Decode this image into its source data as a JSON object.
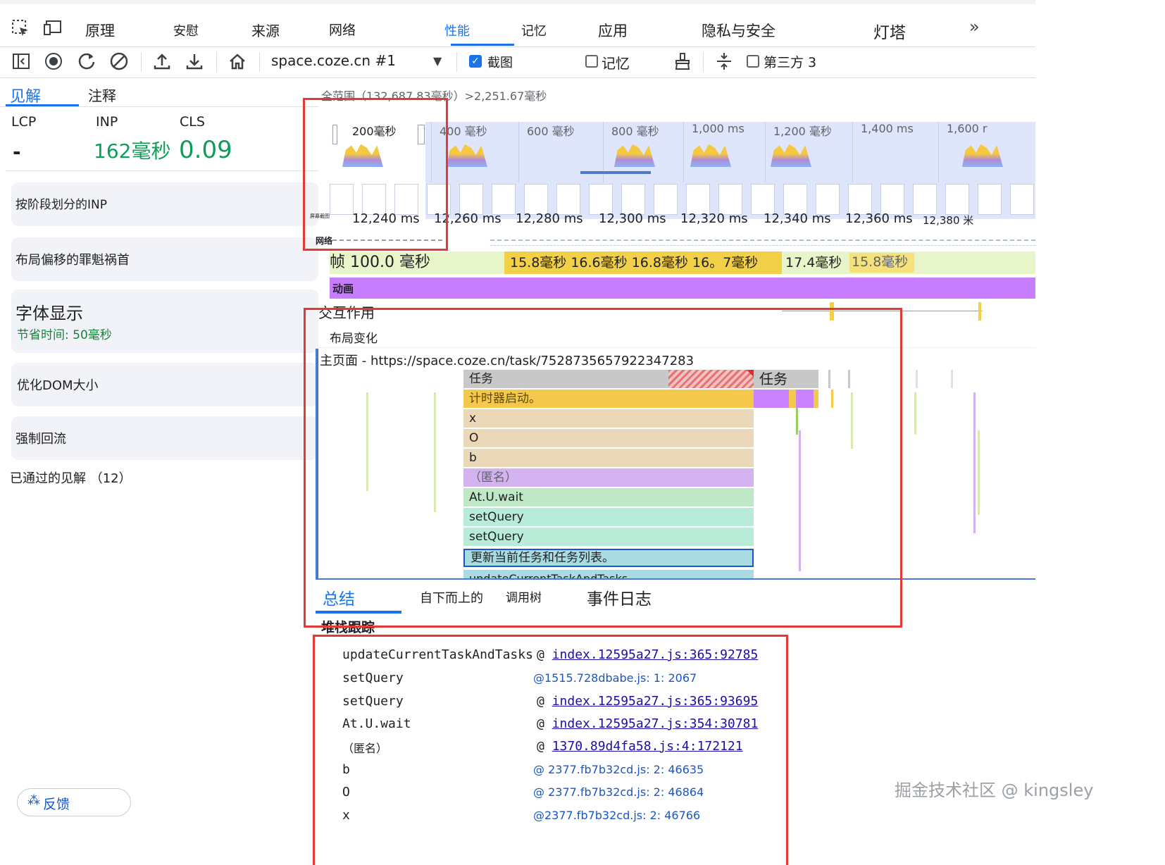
{
  "tabs": [
    "原理",
    "安慰",
    "来源",
    "网络",
    "性能",
    "记忆",
    "应用",
    "隐私与安全",
    "灯塔"
  ],
  "tabs_more": "»",
  "toolbar": {
    "target": "space.coze.cn #1",
    "screenshots_label": "截图",
    "memory_label": "记忆",
    "third_party_label": "第三方 3"
  },
  "sidebar": {
    "tabs": [
      "见解",
      "注释"
    ],
    "metrics": {
      "lcp_label": "LCP",
      "lcp_value": "-",
      "inp_label": "INP",
      "inp_value": "162毫秒",
      "cls_label": "CLS",
      "cls_value": "0.09"
    },
    "cards": {
      "inp_phase": "按阶段划分的INP",
      "layout_shift": "布局偏移的罪魁祸首",
      "font_display": "字体显示",
      "font_saving": "节省时间: 50毫秒",
      "dom_size": "优化DOM大小",
      "forced_reflow": "强制回流"
    },
    "passed": "已通过的见解 （12）",
    "feedback": "反馈"
  },
  "timeline": {
    "range": "全范围（132,687.83毫秒）>2,251.67毫秒",
    "overview_ticks": [
      "200毫秒",
      "400 毫秒",
      "600 毫秒",
      "800 毫秒",
      "1,000 ms",
      "1,200 毫秒",
      "1,400 ms",
      "1,600 r"
    ],
    "ruler_ticks": [
      "12,240 ms",
      "12,260 ms",
      "12,280 ms",
      "12,300 ms",
      "12,320 ms",
      "12,340 ms",
      "12,360 ms",
      "12,380 米"
    ],
    "screenshots_lane_label": "屏幕截图",
    "network_label": "网络",
    "frames_label": "帧 100.0 毫秒",
    "frame_times": "15.8毫秒 16.6毫秒 16.8毫秒 16。7毫秒",
    "frame_time_2": "17.4毫秒",
    "frame_time_3": "15.8毫秒",
    "animation_label": "动画",
    "interactions_label": "交互作用",
    "layout_shifts_label": "布局变化",
    "main_thread": "主页面 - https://space.coze.cn/task/7528735657922347283",
    "flame": {
      "task": "任务",
      "task2": "任务",
      "timer": "计时器启动。",
      "x": "x",
      "o": "O",
      "b": "b",
      "anon": "（匿名）",
      "wait": "At.U.wait",
      "setquery1": "setQuery",
      "setquery2": "setQuery",
      "update_cn": "更新当前任务和任务列表。",
      "update_fn": "updateCurrentTaskAndTasks"
    }
  },
  "bottom": {
    "tabs": [
      "总结",
      "自下而上的",
      "调用树",
      "事件日志"
    ],
    "stack_title": "堆栈跟踪",
    "stack": [
      {
        "fn": "updateCurrentTaskAndTasks",
        "at": "@",
        "src": "index.12595a27.js:365:92785"
      },
      {
        "fn": "setQuery",
        "at": "",
        "src": "@1515.728dbabe.js: 1: 2067"
      },
      {
        "fn": "setQuery",
        "at": "@",
        "src": "index.12595a27.js:365:93695"
      },
      {
        "fn": "At.U.wait",
        "at": "@",
        "src": "index.12595a27.js:354:30781"
      },
      {
        "fn": "（匿名）",
        "at": "@",
        "src": "1370.89d4fa58.js:4:172121"
      },
      {
        "fn": "b",
        "at": "",
        "src": "@ 2377.fb7b32cd.js: 2: 46635"
      },
      {
        "fn": "O",
        "at": "",
        "src": "@ 2377.fb7b32cd.js: 2: 46864"
      },
      {
        "fn": "x",
        "at": "",
        "src": "@2377.fb7b32cd.js: 2: 46766"
      }
    ]
  },
  "watermark": "掘金技术社区 @ kingsley",
  "colors": {
    "accent": "#1a73e8",
    "annotation": "#e53935",
    "inp_good": "#0d9d58",
    "animation": "#c77dff",
    "frames": "#e7f5c8"
  }
}
